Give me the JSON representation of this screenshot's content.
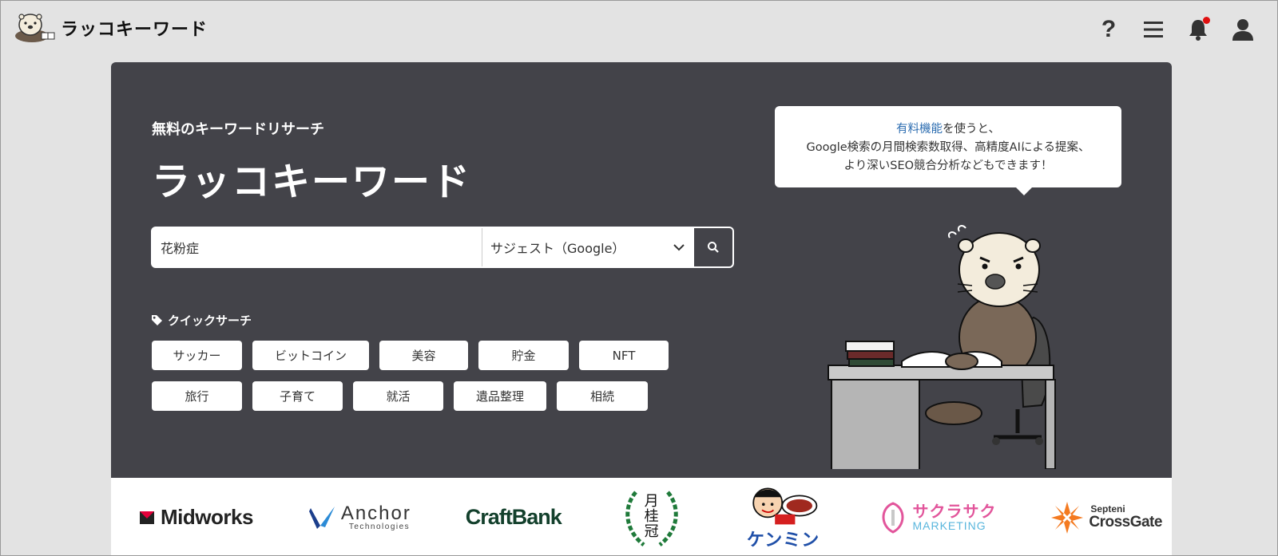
{
  "header": {
    "app_name": "ラッコキーワード",
    "icons": [
      "help-icon",
      "menu-icon",
      "bell-icon",
      "user-icon"
    ],
    "help_glyph": "?"
  },
  "hero": {
    "subtitle": "無料のキーワードリサーチ",
    "title": "ラッコキーワード",
    "search": {
      "value": "花粉症",
      "mode_selected": "サジェスト（Google）"
    },
    "quick_search_label": "クイックサーチ",
    "chips": [
      "サッカー",
      "ビットコイン",
      "美容",
      "貯金",
      "NFT",
      "旅行",
      "子育て",
      "就活",
      "遺品整理",
      "相続"
    ],
    "bubble": {
      "link_text": "有料機能",
      "line1_rest": "を使うと、",
      "line2": "Google検索の月間検索数取得、高精度AIによる提案、",
      "line3": "より深いSEO競合分析などもできます！"
    }
  },
  "logos": {
    "midworks": "Midworks",
    "anchor": "Anchor",
    "anchor_sub": "Technologies",
    "craftbank": "CraftBank",
    "gekkeikan": [
      "月",
      "桂",
      "冠"
    ],
    "kenmin": "ケンミン",
    "sakurasaku": "サクラサク",
    "sakurasaku_sub": "MARKETING",
    "septeni": "Septeni",
    "crossgate": "CrossGate"
  },
  "colors": {
    "hero_bg": "#434349",
    "page_bg": "#e3e3e3",
    "accent_link": "#2b6cb0",
    "notification": "#e01010"
  }
}
